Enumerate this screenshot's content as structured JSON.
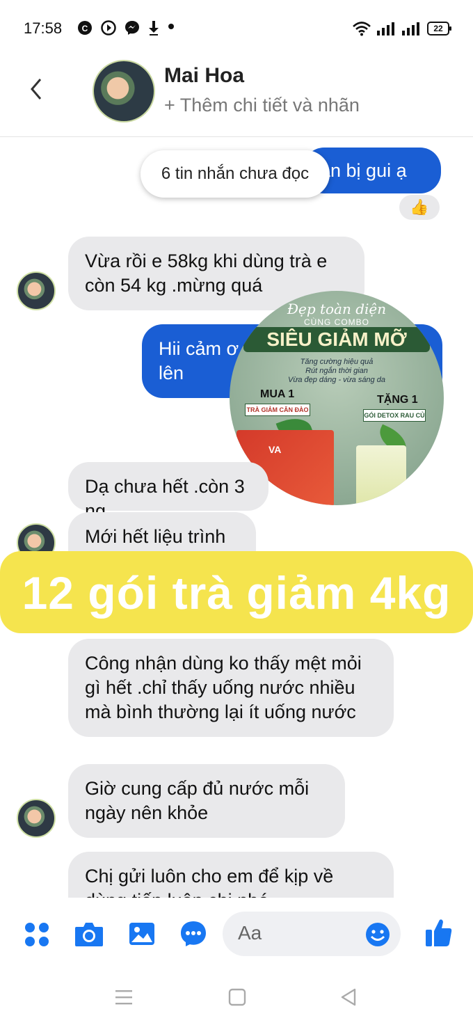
{
  "status": {
    "time": "17:58",
    "battery": "22",
    "left_icons": [
      "cc-icon",
      "play-icon",
      "messenger-icon",
      "download-icon",
      "dot-icon"
    ]
  },
  "header": {
    "name": "Mai Hoa",
    "subtitle": "+ Thêm chi tiết và nhãn"
  },
  "chat": {
    "unread": "6 tin nhắn chưa đọc",
    "out1": "ận bị gui ạ",
    "reaction": "👍",
    "in1": "Vừa rồi e 58kg khi dùng trà e còn 54 kg .mừng quá",
    "out2": "Hii cảm ơ\nlên",
    "in2": "Dạ chưa hết .còn 3 ng",
    "in3": "Mới hết liệu trình",
    "in4": "Công nhận dùng ko thấy mệt mỏi gì hết .chỉ thấy uống nước nhiều mà bình thường lại ít uống nước",
    "in5": "Giờ cung cấp đủ nước mỗi ngày nên khỏe",
    "in6": "Chị gửi luôn cho em để kịp về dùng tiếp luôn chị nhé"
  },
  "promo": {
    "script": "Đẹp toàn diện",
    "combo": "CÙNG COMBO",
    "headline": "SIÊU GIẢM MỠ",
    "taglines": "Tăng cường hiệu quả\nRút ngắn thời gian\nVừa đẹp dáng - vừa sáng da",
    "buy": "MUA 1",
    "gift": "TẶNG 1",
    "buy_item": "TRÀ GIẢM CÂN ĐÀO",
    "gift_item": "GÓI DETOX RAU CỦ",
    "brand": "VA"
  },
  "banner": {
    "text": "12 gói trà giảm 4kg"
  },
  "composer": {
    "placeholder": "Aa"
  },
  "colors": {
    "messenger_blue": "#1a5ed4",
    "icon_blue": "#1877f2",
    "banner_yellow": "#f5e44e",
    "bubble_gray": "#e9e9eb"
  }
}
